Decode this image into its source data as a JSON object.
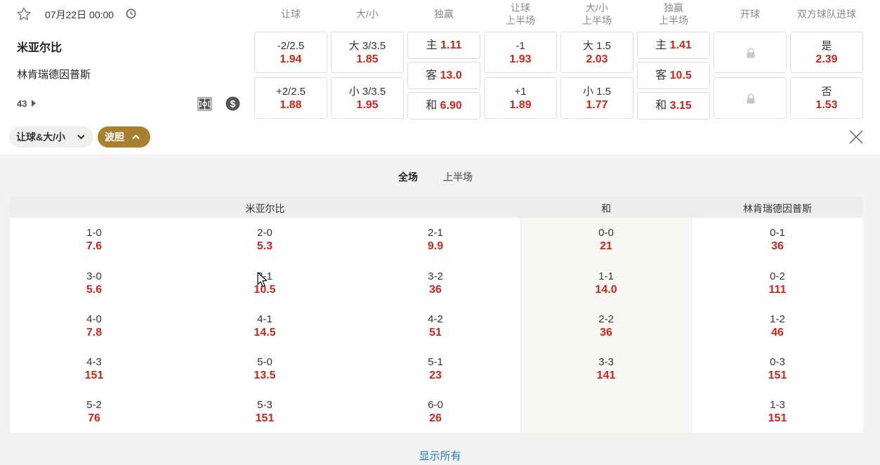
{
  "match": {
    "datetime": "07月22日 00:00",
    "home": "米亚尔比",
    "away": "林肯瑞德因普斯",
    "more_count": "43"
  },
  "columns": {
    "handicap": "让球",
    "ou": "大/小",
    "winner": "独赢",
    "h_handicap": [
      "让球",
      "上半场"
    ],
    "h_ou": [
      "大/小",
      "上半场"
    ],
    "h_winner": [
      "独赢",
      "上半场"
    ],
    "kickoff": "开球",
    "btts": "双方球队进球"
  },
  "odds": {
    "handicap": [
      {
        "line": "-2/2.5",
        "odd": "1.94"
      },
      {
        "line": "+2/2.5",
        "odd": "1.88"
      }
    ],
    "ou": [
      {
        "line": "大 3/3.5",
        "odd": "1.85"
      },
      {
        "line": "小 3/3.5",
        "odd": "1.95"
      }
    ],
    "winner": [
      {
        "label": "主",
        "odd": "1.11"
      },
      {
        "label": "客",
        "odd": "13.0"
      },
      {
        "label": "和",
        "odd": "6.90"
      }
    ],
    "h_handicap": [
      {
        "line": "-1",
        "odd": "1.93"
      },
      {
        "line": "+1",
        "odd": "1.89"
      }
    ],
    "h_ou": [
      {
        "line": "大 1.5",
        "odd": "2.03"
      },
      {
        "line": "小 1.5",
        "odd": "1.77"
      }
    ],
    "h_winner": [
      {
        "label": "主",
        "odd": "1.41"
      },
      {
        "label": "客",
        "odd": "10.5"
      },
      {
        "label": "和",
        "odd": "3.15"
      }
    ],
    "btts": [
      {
        "label": "是",
        "odd": "2.39"
      },
      {
        "label": "否",
        "odd": "1.53"
      }
    ]
  },
  "tags": {
    "tag1": "让球&大/小",
    "tag2": "波胆"
  },
  "period_tabs": [
    "全场",
    "上半场"
  ],
  "correct_score": {
    "home_header": "米亚尔比",
    "draw_header": "和",
    "away_header": "林肯瑞德因普斯",
    "home": [
      [
        {
          "s": "1-0",
          "o": "7.6"
        },
        {
          "s": "2-0",
          "o": "5.3"
        },
        {
          "s": "2-1",
          "o": "9.9"
        }
      ],
      [
        {
          "s": "3-0",
          "o": "5.6"
        },
        {
          "s": "3-1",
          "o": "10.5"
        },
        {
          "s": "3-2",
          "o": "36"
        }
      ],
      [
        {
          "s": "4-0",
          "o": "7.8"
        },
        {
          "s": "4-1",
          "o": "14.5"
        },
        {
          "s": "4-2",
          "o": "51"
        }
      ],
      [
        {
          "s": "4-3",
          "o": "151"
        },
        {
          "s": "5-0",
          "o": "13.5"
        },
        {
          "s": "5-1",
          "o": "23"
        }
      ],
      [
        {
          "s": "5-2",
          "o": "76"
        },
        {
          "s": "5-3",
          "o": "151"
        },
        {
          "s": "6-0",
          "o": "26"
        }
      ]
    ],
    "draw": [
      {
        "s": "0-0",
        "o": "21"
      },
      {
        "s": "1-1",
        "o": "14.0"
      },
      {
        "s": "2-2",
        "o": "36"
      },
      {
        "s": "3-3",
        "o": "141"
      }
    ],
    "away": [
      {
        "s": "0-1",
        "o": "36"
      },
      {
        "s": "0-2",
        "o": "111"
      },
      {
        "s": "1-2",
        "o": "46"
      },
      {
        "s": "0-3",
        "o": "151"
      },
      {
        "s": "1-3",
        "o": "151"
      }
    ]
  },
  "show_all": "显示所有",
  "colors": {
    "odds_red": "#c8261c",
    "tag_gold": "#a88030",
    "link_blue": "#2e78c2"
  },
  "icons": [
    "star-icon",
    "clock-icon",
    "pitch-icon",
    "dollar-icon",
    "lock-icon",
    "chevron-down-icon",
    "chevron-up-icon",
    "close-icon"
  ]
}
